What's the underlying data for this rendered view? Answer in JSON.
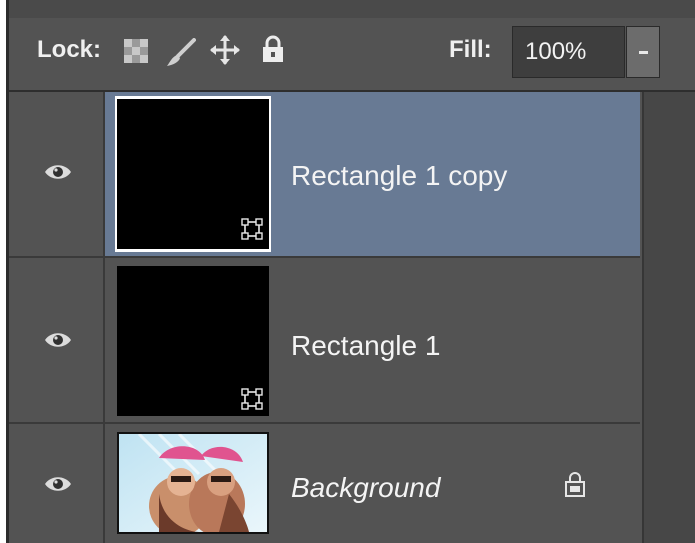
{
  "lockbar": {
    "lock_label": "Lock:",
    "fill_label": "Fill:",
    "fill_value": "100%"
  },
  "layers": [
    {
      "name": "Rectangle 1 copy",
      "selected": true,
      "visible": true,
      "type": "shape"
    },
    {
      "name": "Rectangle 1",
      "selected": false,
      "visible": true,
      "type": "shape"
    },
    {
      "name": "Background",
      "selected": false,
      "visible": true,
      "type": "image",
      "locked": true
    }
  ],
  "colors": {
    "panel_bg": "#535353",
    "selected_row": "#687a94",
    "text": "#f4f4f4"
  },
  "icons": [
    "lock-transparent-pixels-icon",
    "lock-image-pixels-icon",
    "lock-position-icon",
    "lock-all-icon",
    "eye-icon",
    "vector-mask-icon",
    "layer-lock-icon"
  ]
}
